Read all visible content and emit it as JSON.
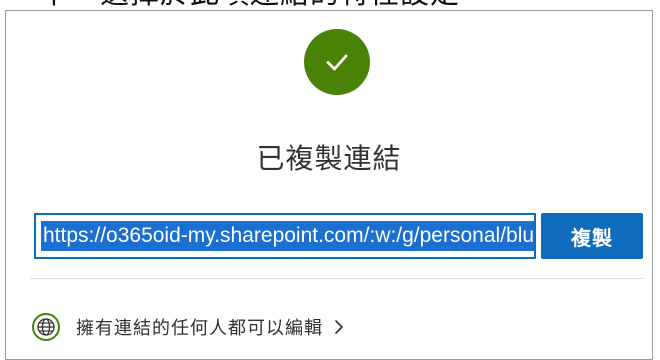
{
  "caption": {
    "text": "下一選擇於此項連結的特性設定"
  },
  "dialog": {
    "title": "已複製連結",
    "link_value": "https://o365oid-my.sharepoint.com/:w:/g/personal/blue",
    "copy_button_label": "複製",
    "permission_text": "擁有連結的任何人都可以編輯",
    "chevron_glyph": "›"
  },
  "icons": {
    "success": "checkmark-icon",
    "permission": "globe-icon",
    "expand": "chevron-right-icon"
  },
  "colors": {
    "success_green": "#498205",
    "accent_blue": "#0f6cbd",
    "selection_blue": "#1a6fd1",
    "text": "#323130",
    "border": "#9a9a9a"
  }
}
